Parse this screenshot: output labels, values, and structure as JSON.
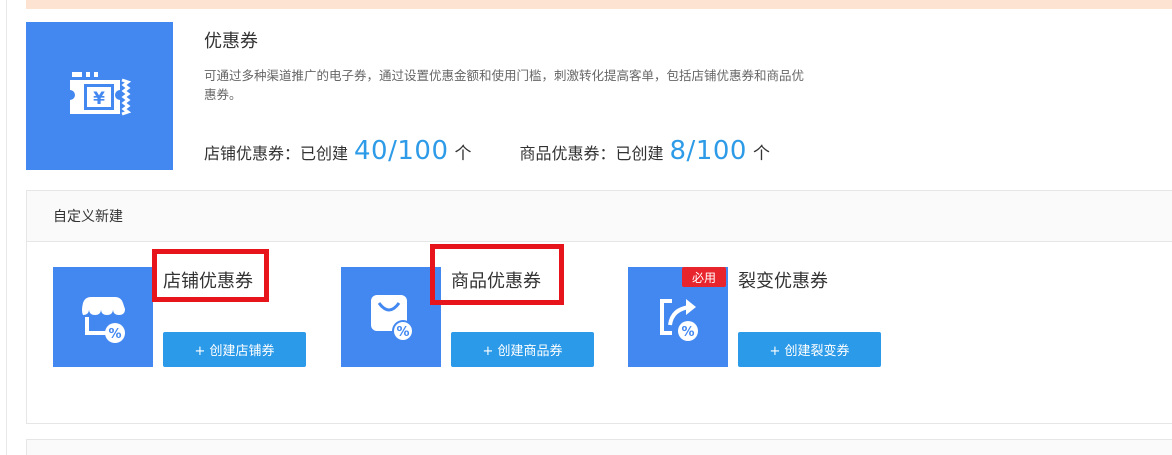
{
  "colors": {
    "brand_blue": "#4388f1",
    "accent_blue": "#2d9be8",
    "button_blue": "#2b9ae8",
    "highlight_red": "#e8141c",
    "banner_peach": "#fde3d2"
  },
  "intro": {
    "icon": "coupon-yen-icon",
    "title": "优惠券",
    "description": "可通过多种渠道推广的电子券，通过设置优惠金额和使用门槛，刺激转化提高客单，包括店铺优惠券和商品优惠券。",
    "stats": [
      {
        "label": "店铺优惠券：已创建",
        "value": "40/100",
        "unit": "个"
      },
      {
        "label": "商品优惠券：已创建",
        "value": "8/100",
        "unit": "个"
      }
    ]
  },
  "custom_create": {
    "title": "自定义新建",
    "cards": [
      {
        "icon": "shop-discount-icon",
        "title": "店铺优惠券",
        "button": "+ 创建店铺券",
        "highlighted": true,
        "tag": ""
      },
      {
        "icon": "bag-discount-icon",
        "title": "商品优惠券",
        "button": "+ 创建商品券",
        "highlighted": true,
        "tag": ""
      },
      {
        "icon": "share-discount-icon",
        "title": "裂变优惠券",
        "button": "+ 创建裂变券",
        "highlighted": false,
        "tag": "必用"
      }
    ]
  }
}
